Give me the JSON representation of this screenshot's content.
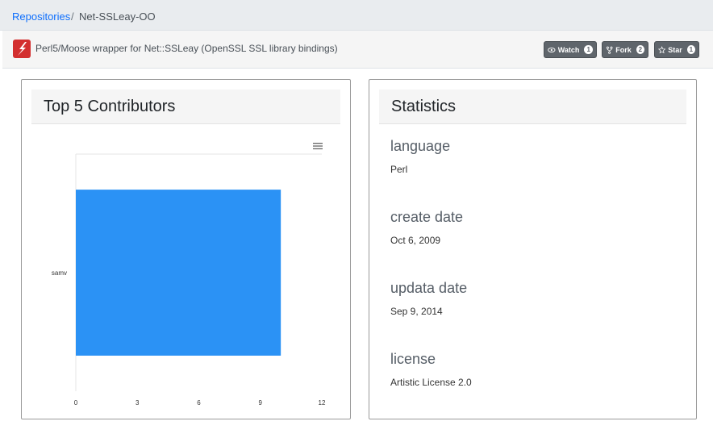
{
  "breadcrumb": {
    "root_label": "Repositories",
    "separator": "/",
    "current": "Net-SSLeay-OO"
  },
  "repo": {
    "description": "Perl5/Moose wrapper for Net::SSLeay (OpenSSL SSL library bindings)",
    "logo_icon": "perl-logo-icon",
    "buttons": [
      {
        "label": "Watch",
        "count": "1",
        "icon": "eye-icon"
      },
      {
        "label": "Fork",
        "count": "2",
        "icon": "fork-icon"
      },
      {
        "label": "Star",
        "count": "1",
        "icon": "star-icon"
      }
    ]
  },
  "contributors": {
    "title": "Top 5 Contributors",
    "menu_icon": "hamburger-menu-icon"
  },
  "statistics": {
    "title": "Statistics",
    "items": [
      {
        "label": "language",
        "value": "Perl"
      },
      {
        "label": "create date",
        "value": "Oct 6, 2009"
      },
      {
        "label": "updata date",
        "value": "Sep 9, 2014"
      },
      {
        "label": "license",
        "value": "Artistic License 2.0"
      }
    ]
  },
  "colors": {
    "bar": "#2b92f5",
    "link": "#0d6efd",
    "button": "#5f656b"
  },
  "chart_data": {
    "type": "bar",
    "orientation": "horizontal",
    "title": "",
    "categories": [
      "samv"
    ],
    "values": [
      10
    ],
    "xlabel": "",
    "ylabel": "",
    "xlim": [
      0,
      12
    ],
    "x_ticks": [
      "0",
      "3",
      "6",
      "9",
      "12"
    ],
    "grid": true,
    "legend": "none"
  }
}
